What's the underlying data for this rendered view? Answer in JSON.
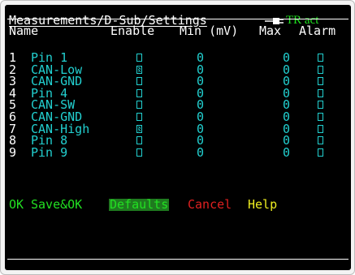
{
  "title": "Measurements/D-Sub/Settings",
  "status": {
    "label": "TR act",
    "icon": "plug-icon",
    "color": "#22e022"
  },
  "columns": {
    "name": "Name",
    "enable": "Enable",
    "min": "Min (mV)",
    "max": "Max",
    "alarm": "Alarm"
  },
  "pins": [
    {
      "num": "1",
      "name": "Pin 1",
      "enable": false,
      "min": "0",
      "max": "0",
      "alarm": false
    },
    {
      "num": "2",
      "name": "CAN-Low",
      "enable": true,
      "min": "0",
      "max": "0",
      "alarm": false
    },
    {
      "num": "3",
      "name": "CAN-GND",
      "enable": false,
      "min": "0",
      "max": "0",
      "alarm": false
    },
    {
      "num": "4",
      "name": "Pin 4",
      "enable": false,
      "min": "0",
      "max": "0",
      "alarm": false
    },
    {
      "num": "5",
      "name": "CAN-SW",
      "enable": false,
      "min": "0",
      "max": "0",
      "alarm": false
    },
    {
      "num": "6",
      "name": "CAN-GND",
      "enable": false,
      "min": "0",
      "max": "0",
      "alarm": false
    },
    {
      "num": "7",
      "name": "CAN-High",
      "enable": true,
      "min": "0",
      "max": "0",
      "alarm": false
    },
    {
      "num": "8",
      "name": "Pin 8",
      "enable": false,
      "min": "0",
      "max": "0",
      "alarm": false
    },
    {
      "num": "9",
      "name": "Pin 9",
      "enable": false,
      "min": "0",
      "max": "0",
      "alarm": false
    }
  ],
  "softkeys": {
    "ok": "OK",
    "save_ok": "Save&OK",
    "defaults": "Defaults",
    "cancel": "Cancel",
    "help": "Help"
  },
  "colors": {
    "background": "#000000",
    "text": "#ffffff",
    "value": "#22d0d0",
    "ok": "#22e022",
    "selected_bg": "#1f7a1f",
    "cancel": "#e02020",
    "help": "#f0f020"
  }
}
